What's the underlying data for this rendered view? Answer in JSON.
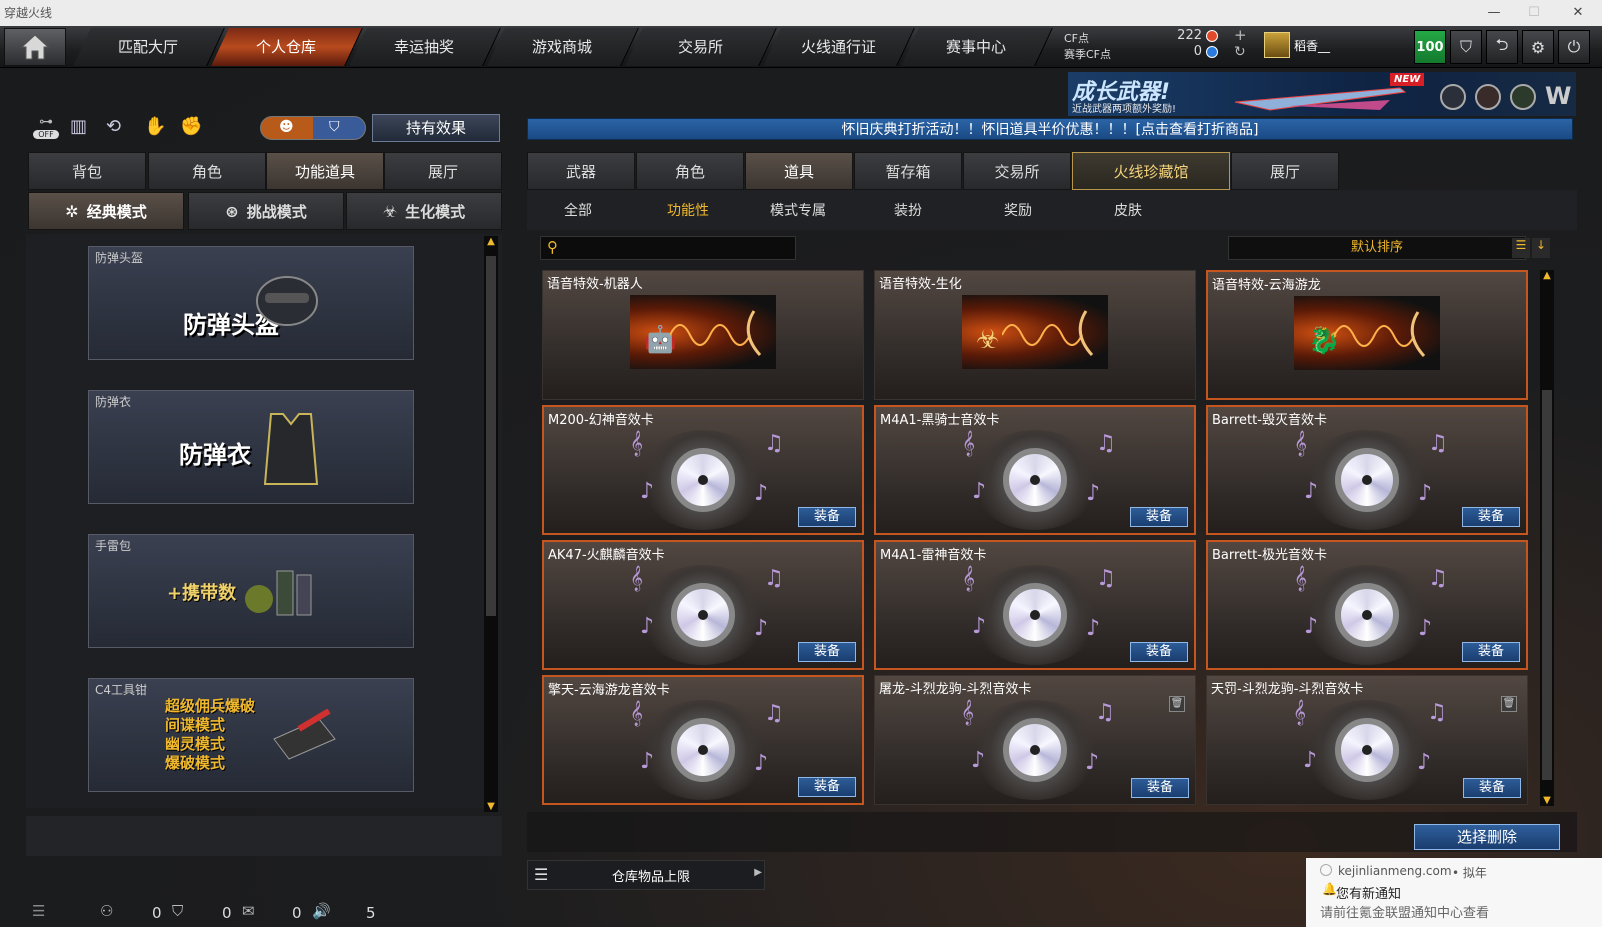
{
  "window": {
    "title": "穿越火线"
  },
  "nav": {
    "tabs": [
      "匹配大厅",
      "个人仓库",
      "幸运抽奖",
      "游戏商城",
      "交易所",
      "火线通行证",
      "赛事中心"
    ],
    "active_index": 1
  },
  "currency": {
    "cf_label": "CF点",
    "cf_value": "222",
    "season_cf_label": "赛季CF点",
    "season_cf_value": "0",
    "player_name": "稻香__",
    "level_badge": "100"
  },
  "banner": {
    "title": "成长武器!",
    "subtitle": "近战武器两项额外奖励!",
    "tag": "NEW"
  },
  "ticker": "怀旧庆典打折活动！！怀旧道具半价优惠！！！[点击查看打折商品]",
  "left_panel": {
    "off_label": "OFF",
    "effects_button": "持有效果",
    "tabs": [
      "背包",
      "角色",
      "功能道具",
      "展厅"
    ],
    "active_tab": 2,
    "modes": [
      "经典模式",
      "挑战模式",
      "生化模式"
    ],
    "cards": [
      {
        "label": "防弹头盔",
        "caption": "防弹头盔"
      },
      {
        "label": "防弹衣",
        "caption": "防弹衣"
      },
      {
        "label": "手雷包",
        "caption": "+携带数"
      },
      {
        "label": "C4工具钳",
        "lines": [
          "超级佣兵爆破",
          "间谍模式",
          "幽灵模式",
          "爆破模式"
        ]
      }
    ]
  },
  "right_panel": {
    "tabs": [
      "武器",
      "角色",
      "道具",
      "暂存箱",
      "交易所",
      "火线珍藏馆",
      "展厅"
    ],
    "active_tab": 2,
    "highlight_tab": 5,
    "subtabs": [
      "全部",
      "功能性",
      "模式专属",
      "装扮",
      "奖励",
      "皮肤"
    ],
    "active_subtab": 1,
    "search_placeholder": "",
    "sort_label": "默认排序",
    "equip_label": "装备",
    "items": [
      {
        "title": "语音特效-机器人",
        "kind": "fx",
        "glyph": "🤖",
        "selected": false,
        "equip": false,
        "trash": false
      },
      {
        "title": "语音特效-生化",
        "kind": "fx",
        "glyph": "☣",
        "selected": false,
        "equip": false,
        "trash": false
      },
      {
        "title": "语音特效-云海游龙",
        "kind": "fx",
        "glyph": "🐉",
        "selected": true,
        "equip": false,
        "trash": false
      },
      {
        "title": "M200-幻神音效卡",
        "kind": "disc",
        "selected": true,
        "equip": true,
        "trash": false
      },
      {
        "title": "M4A1-黑骑士音效卡",
        "kind": "disc",
        "selected": true,
        "equip": true,
        "trash": false
      },
      {
        "title": "Barrett-毁灭音效卡",
        "kind": "disc",
        "selected": true,
        "equip": true,
        "trash": false
      },
      {
        "title": "AK47-火麒麟音效卡",
        "kind": "disc",
        "selected": true,
        "equip": true,
        "trash": false
      },
      {
        "title": "M4A1-雷神音效卡",
        "kind": "disc",
        "selected": true,
        "equip": true,
        "trash": false
      },
      {
        "title": "Barrett-极光音效卡",
        "kind": "disc",
        "selected": true,
        "equip": true,
        "trash": false
      },
      {
        "title": "擎天-云海游龙音效卡",
        "kind": "disc",
        "selected": true,
        "equip": true,
        "trash": false
      },
      {
        "title": "屠龙-斗烈龙驹-斗烈音效卡",
        "kind": "disc",
        "selected": false,
        "equip": true,
        "trash": true
      },
      {
        "title": "天罚-斗烈龙驹-斗烈音效卡",
        "kind": "disc",
        "selected": false,
        "equip": true,
        "trash": true
      }
    ],
    "delete_button": "选择删除",
    "storage_label": "仓库物品上限"
  },
  "statusbar": {
    "counts": [
      "0",
      "0",
      "0",
      "5"
    ]
  },
  "notification": {
    "site": "kejinlianmeng.com",
    "site_suffix": "• 拟年",
    "title": "您有新通知",
    "body": "请前往氪金联盟通知中心查看"
  }
}
